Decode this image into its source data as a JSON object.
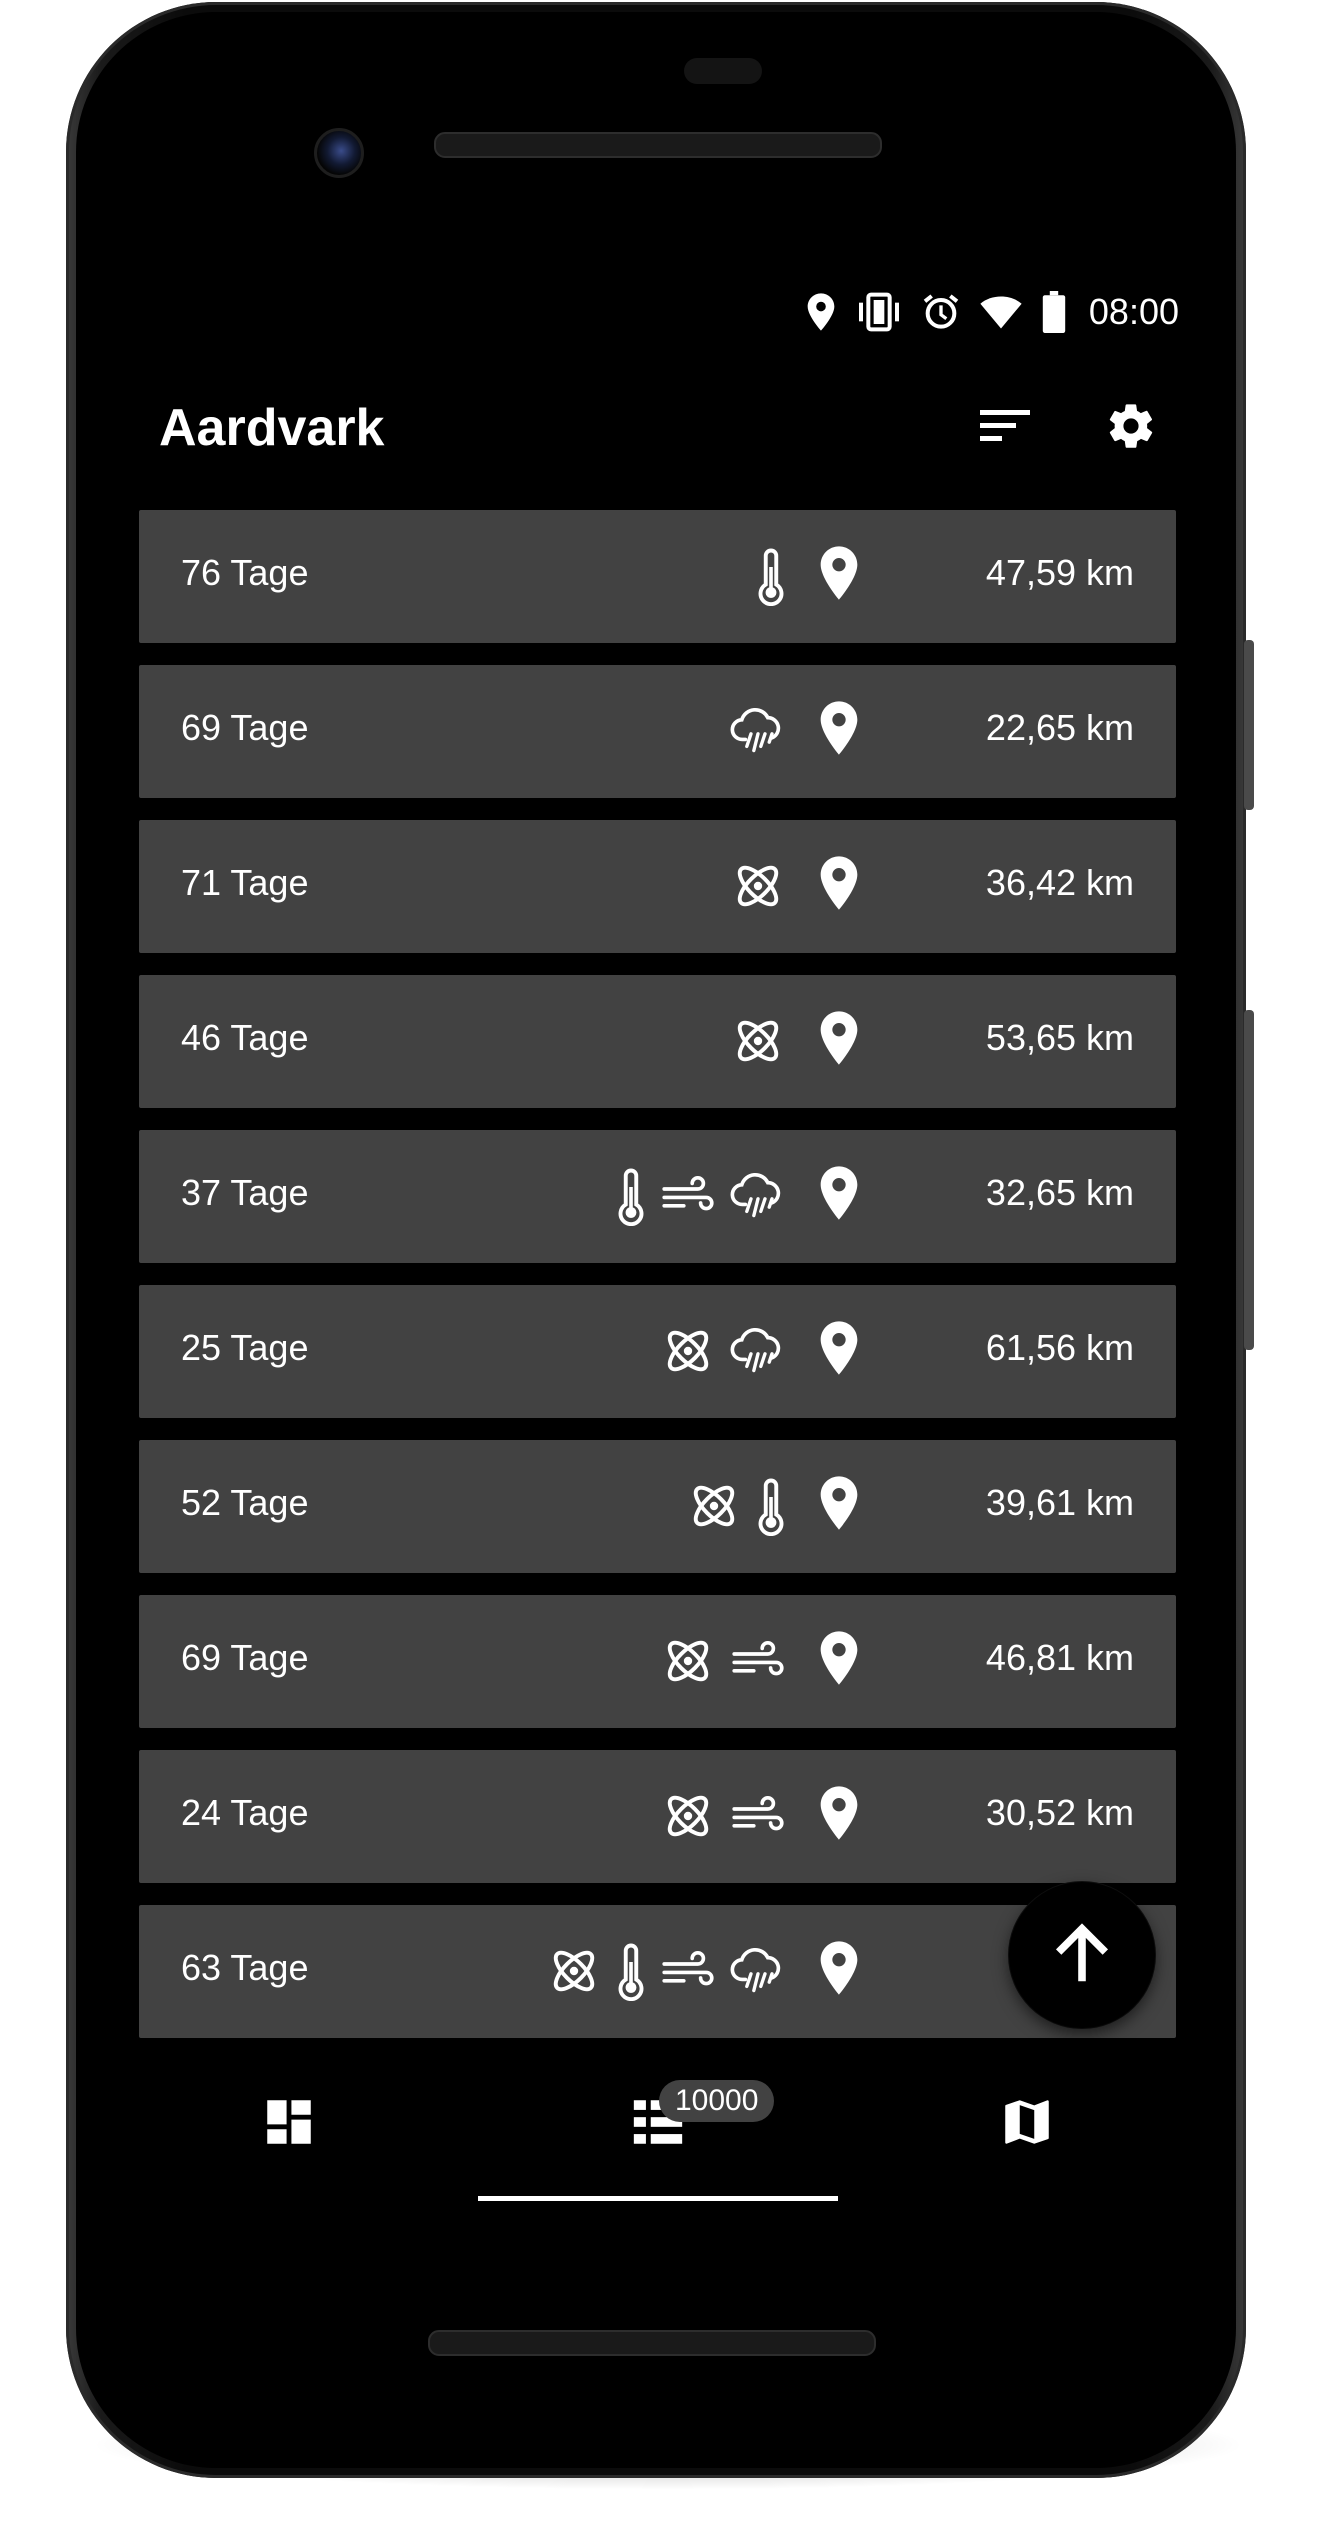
{
  "status_bar": {
    "time": "08:00",
    "icons": [
      "location-icon",
      "vibrate-icon",
      "alarm-icon",
      "wifi-icon",
      "battery-icon"
    ]
  },
  "toolbar": {
    "title": "Aardvark",
    "actions": [
      "sort-icon",
      "settings-icon"
    ]
  },
  "list": {
    "items": [
      {
        "days": "76 Tage",
        "icons": [
          "thermometer-icon"
        ],
        "distance": "47,59 km"
      },
      {
        "days": "69 Tage",
        "icons": [
          "rain-cloud-icon"
        ],
        "distance": "22,65 km"
      },
      {
        "days": "71 Tage",
        "icons": [
          "atom-icon"
        ],
        "distance": "36,42 km"
      },
      {
        "days": "46 Tage",
        "icons": [
          "atom-icon"
        ],
        "distance": "53,65 km"
      },
      {
        "days": "37 Tage",
        "icons": [
          "thermometer-icon",
          "wind-icon",
          "rain-cloud-icon"
        ],
        "distance": "32,65 km"
      },
      {
        "days": "25 Tage",
        "icons": [
          "atom-icon",
          "rain-cloud-icon"
        ],
        "distance": "61,56 km"
      },
      {
        "days": "52 Tage",
        "icons": [
          "atom-icon",
          "thermometer-icon"
        ],
        "distance": "39,61 km"
      },
      {
        "days": "69 Tage",
        "icons": [
          "atom-icon",
          "wind-icon"
        ],
        "distance": "46,81 km"
      },
      {
        "days": "24 Tage",
        "icons": [
          "atom-icon",
          "wind-icon"
        ],
        "distance": "30,52 km"
      },
      {
        "days": "63 Tage",
        "icons": [
          "atom-icon",
          "thermometer-icon",
          "wind-icon",
          "rain-cloud-icon"
        ],
        "distance": "43,"
      }
    ]
  },
  "fab": {
    "icon": "arrow-up-icon"
  },
  "bottom_nav": {
    "items": [
      {
        "icon": "dashboard-icon"
      },
      {
        "icon": "list-icon",
        "badge": "10000",
        "selected": true
      },
      {
        "icon": "map-icon"
      }
    ]
  },
  "colors": {
    "background": "#000000",
    "card": "#424242",
    "text": "#ffffff"
  }
}
